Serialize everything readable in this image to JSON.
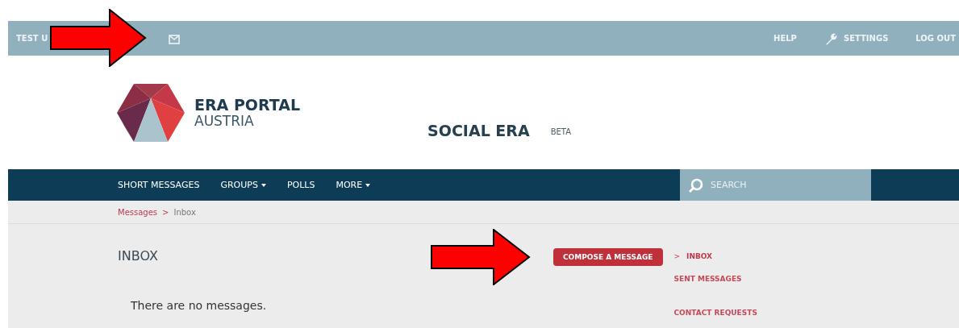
{
  "top_bar": {
    "user": "TEST U",
    "links": [
      {
        "kind": "text",
        "label": "HELP"
      },
      {
        "kind": "wrench",
        "label": "SETTINGS"
      },
      {
        "kind": "text",
        "label": "LOG OUT"
      }
    ]
  },
  "header": {
    "logo_line_1": "ERA PORTAL",
    "logo_line_2": "AUSTRIA",
    "title": "SOCIAL ERA",
    "badge": "BETA"
  },
  "nav": {
    "items": [
      {
        "label": "SHORT MESSAGES",
        "dropdown": false
      },
      {
        "label": "GROUPS",
        "dropdown": true
      },
      {
        "label": "POLLS",
        "dropdown": false
      },
      {
        "label": "MORE",
        "dropdown": true
      }
    ],
    "search": {
      "placeholder": "SEARCH"
    }
  },
  "breadcrumb": {
    "parent": "Messages",
    "separator": ">",
    "current": "Inbox"
  },
  "content": {
    "heading": "INBOX",
    "empty_text": "There are no messages.",
    "compose_button": "COMPOSE A MESSAGE"
  },
  "side_menu": {
    "marker": ">",
    "items": [
      {
        "label": "INBOX",
        "selected": true
      },
      {
        "label": "SENT MESSAGES",
        "selected": false
      },
      {
        "label": "CONTACT REQUESTS",
        "selected": false
      }
    ]
  }
}
